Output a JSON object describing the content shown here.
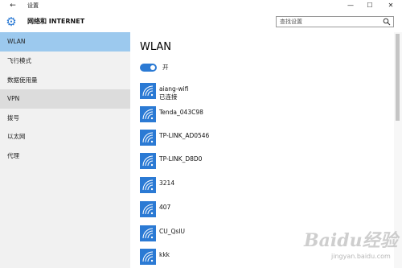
{
  "window": {
    "title": "设置",
    "back_icon": "back-arrow-icon",
    "minimize_glyph": "—",
    "maximize_glyph": "☐",
    "close_glyph": "✕"
  },
  "header": {
    "title": "网络和 INTERNET",
    "icon": "gear-icon",
    "search_placeholder": "查找设置"
  },
  "sidebar": {
    "items": [
      {
        "label": "WLAN",
        "state": "selected"
      },
      {
        "label": "飞行模式",
        "state": "normal"
      },
      {
        "label": "数据使用量",
        "state": "normal"
      },
      {
        "label": "VPN",
        "state": "hover"
      },
      {
        "label": "拨号",
        "state": "normal"
      },
      {
        "label": "以太网",
        "state": "normal"
      },
      {
        "label": "代理",
        "state": "normal"
      }
    ]
  },
  "main": {
    "title": "WLAN",
    "toggle": {
      "label": "开",
      "on": true
    },
    "networks": [
      {
        "name": "aiang-wifi",
        "status": "已连接"
      },
      {
        "name": "Tenda_043C98",
        "status": ""
      },
      {
        "name": "TP-LINK_AD0546",
        "status": ""
      },
      {
        "name": "TP-LINK_D8D0",
        "status": ""
      },
      {
        "name": "3214",
        "status": ""
      },
      {
        "name": "407",
        "status": ""
      },
      {
        "name": "CU_QsIU",
        "status": ""
      },
      {
        "name": "kkk",
        "status": ""
      }
    ]
  },
  "colors": {
    "accent": "#2b7ad4",
    "selected_bg": "#9cc9ee",
    "hover_bg": "#dcdcdc",
    "sidebar_bg": "#f1f1f1"
  },
  "watermark": {
    "main": "Baidu经验",
    "sub": "jingyan.baidu.com"
  }
}
